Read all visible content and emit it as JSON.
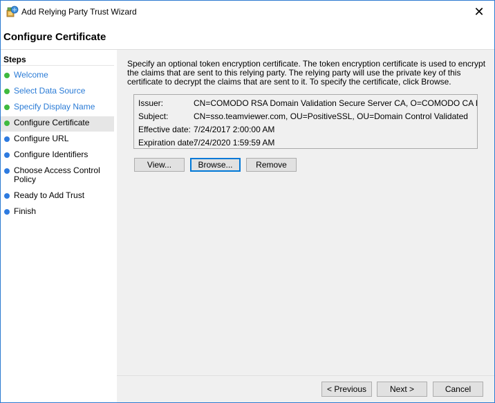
{
  "window": {
    "title": "Add Relying Party Trust Wizard",
    "close_glyph": "✕"
  },
  "page": {
    "title": "Configure Certificate"
  },
  "steps": {
    "header": "Steps",
    "items": [
      {
        "label": "Welcome",
        "state": "done"
      },
      {
        "label": "Select Data Source",
        "state": "done"
      },
      {
        "label": "Specify Display Name",
        "state": "done"
      },
      {
        "label": "Configure Certificate",
        "state": "current"
      },
      {
        "label": "Configure URL",
        "state": "todo"
      },
      {
        "label": "Configure Identifiers",
        "state": "todo"
      },
      {
        "label": "Choose Access Control Policy",
        "state": "todo"
      },
      {
        "label": "Ready to Add Trust",
        "state": "todo"
      },
      {
        "label": "Finish",
        "state": "todo"
      }
    ],
    "colors": {
      "done_dot": "#3fba3f",
      "todo_dot": "#2e7be0",
      "done_text": "#2a7bd6"
    }
  },
  "content": {
    "intro": "Specify an optional token encryption certificate.  The token encryption certificate is used to encrypt the claims that are sent to this relying party.  The relying party will use the private key of this certificate to decrypt the claims that are sent to it.  To specify the certificate, click Browse.",
    "certificate": {
      "issuer_label": "Issuer:",
      "issuer_value": "CN=COMODO RSA Domain Validation Secure Server CA, O=COMODO CA Limited, L=Salford",
      "subject_label": "Subject:",
      "subject_value": "CN=sso.teamviewer.com, OU=PositiveSSL, OU=Domain Control Validated",
      "effective_label": "Effective date:",
      "effective_value": "7/24/2017 2:00:00 AM",
      "expiration_label": "Expiration date:",
      "expiration_value": "7/24/2020 1:59:59 AM"
    },
    "buttons": {
      "view": "View...",
      "browse": "Browse...",
      "remove": "Remove"
    }
  },
  "footer": {
    "previous": "< Previous",
    "next": "Next >",
    "cancel": "Cancel"
  }
}
